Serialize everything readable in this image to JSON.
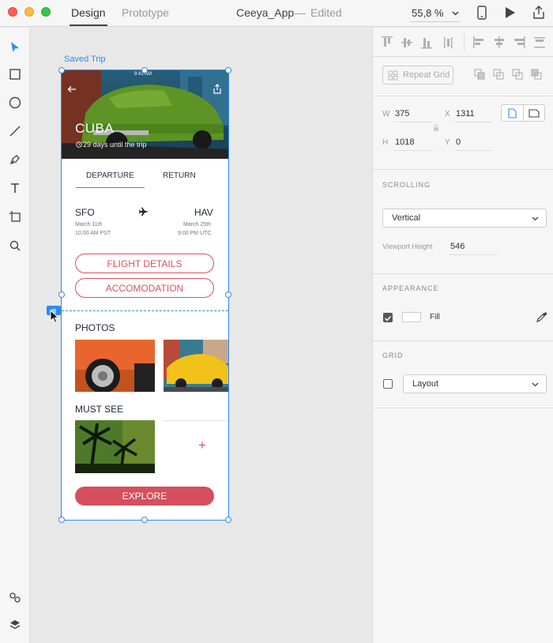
{
  "window": {
    "mode_tabs": [
      "Design",
      "Prototype"
    ],
    "document_title": "Ceeya_App",
    "separator": "—",
    "status": "Edited",
    "zoom": "55,8 %"
  },
  "artboard": {
    "label": "Saved Trip",
    "status_time": "9:41 AM",
    "hero_title": "CUBA",
    "hero_subtitle": "29 days until the trip",
    "tabs": [
      "DEPARTURE",
      "RETURN"
    ],
    "from_city": "SFO",
    "to_city": "HAV",
    "from_date": "March  11th",
    "from_time": "10:00 AM PST",
    "to_date": "March 25th",
    "to_time": "9:00 PM UTC",
    "flight_details": "FLIGHT DETAILS",
    "accommodation": "ACCOMODATION",
    "photos_title": "PHOTOS",
    "must_see_title": "MUST SEE",
    "add_symbol": "+",
    "explore": "EXPLORE"
  },
  "inspector": {
    "repeat_grid": "Repeat Grid",
    "w_label": "W",
    "w_value": "375",
    "x_label": "X",
    "x_value": "1311",
    "h_label": "H",
    "h_value": "1018",
    "y_label": "Y",
    "y_value": "0",
    "scrolling_title": "SCROLLING",
    "scrolling_value": "Vertical",
    "viewport_label": "Viewport Height",
    "viewport_value": "546",
    "appearance_title": "APPEARANCE",
    "fill_label": "Fill",
    "fill_checked": true,
    "grid_title": "GRID",
    "grid_checked": false,
    "grid_value": "Layout"
  },
  "colors": {
    "selection": "#2d8ceb",
    "accent": "#d9505e",
    "explore": "#d64f5e"
  }
}
